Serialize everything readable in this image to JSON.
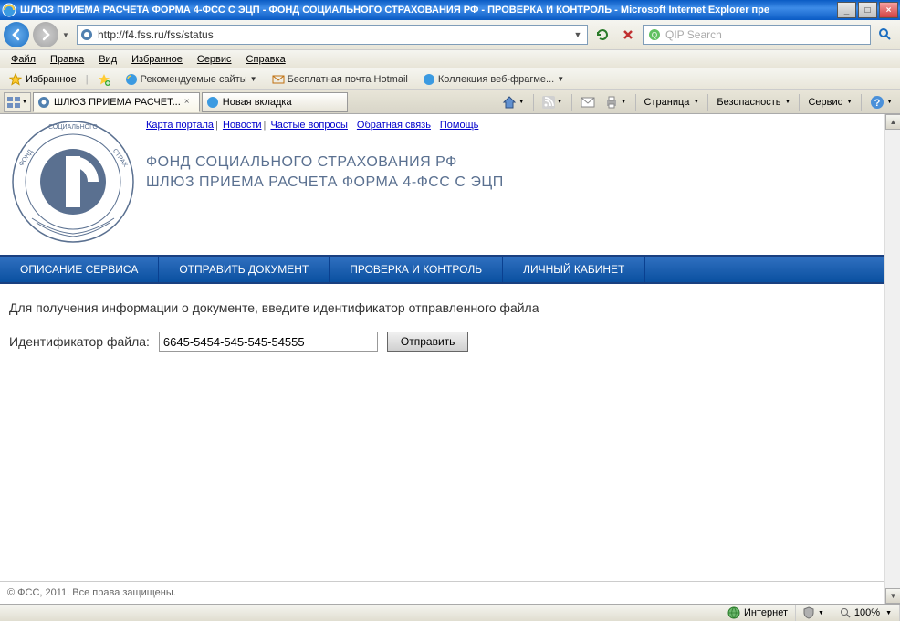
{
  "window": {
    "title": "ШЛЮЗ ПРИЕМА РАСЧЕТА ФОРМА 4-ФСС С ЭЦП - ФОНД СОЦИАЛЬНОГО СТРАХОВАНИЯ РФ - ПРОВЕРКА И КОНТРОЛЬ - Microsoft Internet Explorer пре"
  },
  "address_bar": {
    "url": "http://f4.fss.ru/fss/status"
  },
  "search_bar": {
    "placeholder": "QIP Search"
  },
  "menu": {
    "items": [
      "Файл",
      "Правка",
      "Вид",
      "Избранное",
      "Сервис",
      "Справка"
    ]
  },
  "favorites_bar": {
    "label": "Избранное",
    "items": [
      "Рекомендуемые сайты",
      "Бесплатная почта Hotmail",
      "Коллекция веб-фрагме..."
    ]
  },
  "tabs": [
    {
      "label": "ШЛЮЗ ПРИЕМА РАСЧЕТ...",
      "active": true
    },
    {
      "label": "Новая вкладка",
      "active": false
    }
  ],
  "command_bar": {
    "items": [
      "Страница",
      "Безопасность",
      "Сервис"
    ]
  },
  "page": {
    "top_links": [
      "Карта портала",
      "Новости",
      "Частые вопросы",
      "Обратная связь",
      "Помощь"
    ],
    "org_title": "ФОНД СОЦИАЛЬНОГО СТРАХОВАНИЯ РФ",
    "org_subtitle": "ШЛЮЗ ПРИЕМА РАСЧЕТА ФОРМА 4-ФСС С ЭЦП",
    "main_nav": [
      "ОПИСАНИЕ СЕРВИСА",
      "ОТПРАВИТЬ ДОКУМЕНТ",
      "ПРОВЕРКА И КОНТРОЛЬ",
      "ЛИЧНЫЙ КАБИНЕТ"
    ],
    "form": {
      "prompt": "Для получения информации о документе, введите идентификатор отправленного файла",
      "label": "Идентификатор файла:",
      "value": "6645-5454-545-545-54555",
      "button": "Отправить"
    },
    "footer": "© ФСС, 2011. Все права защищены."
  },
  "status_bar": {
    "zone": "Интернет",
    "zoom": "100%"
  }
}
